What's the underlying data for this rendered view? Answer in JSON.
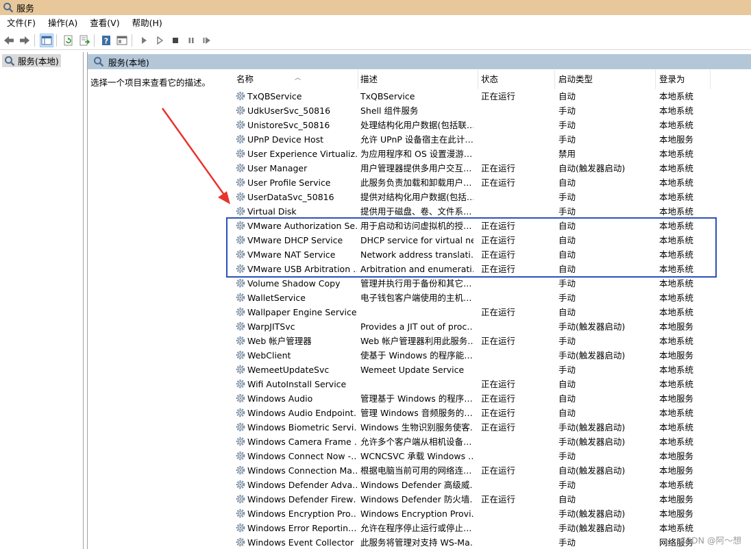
{
  "window": {
    "title": "服务"
  },
  "menu": [
    "文件(F)",
    "操作(A)",
    "查看(V)",
    "帮助(H)"
  ],
  "toolbar": {
    "icons": [
      "back-arrow-icon",
      "forward-arrow-icon",
      "show-console-tree-icon",
      "refresh-icon",
      "export-list-icon",
      "help-icon",
      "properties-icon",
      "start-service-icon",
      "start-service-alt-icon",
      "stop-service-icon",
      "pause-service-icon",
      "resume-service-icon"
    ]
  },
  "tree": {
    "root_label": "服务(本地)"
  },
  "main": {
    "header_label": "服务(本地)",
    "description_hint": "选择一个项目来查看它的描述。"
  },
  "columns": {
    "name": "名称",
    "desc": "描述",
    "status": "状态",
    "startup": "启动类型",
    "logon": "登录为"
  },
  "services": [
    {
      "name": "TxQBService",
      "desc": "TxQBService",
      "status": "正在运行",
      "startup": "自动",
      "logon": "本地系统"
    },
    {
      "name": "UdkUserSvc_50816",
      "desc": "Shell 组件服务",
      "status": "",
      "startup": "手动",
      "logon": "本地系统"
    },
    {
      "name": "UnistoreSvc_50816",
      "desc": "处理结构化用户数据(包括联…",
      "status": "",
      "startup": "手动",
      "logon": "本地系统"
    },
    {
      "name": "UPnP Device Host",
      "desc": "允许 UPnP 设备宿主在此计…",
      "status": "",
      "startup": "手动",
      "logon": "本地服务"
    },
    {
      "name": "User Experience Virtualiz…",
      "desc": "为应用程序和 OS 设置漫游…",
      "status": "",
      "startup": "禁用",
      "logon": "本地系统"
    },
    {
      "name": "User Manager",
      "desc": "用户管理器提供多用户交互…",
      "status": "正在运行",
      "startup": "自动(触发器启动)",
      "logon": "本地系统"
    },
    {
      "name": "User Profile Service",
      "desc": "此服务负责加载和卸载用户…",
      "status": "正在运行",
      "startup": "自动",
      "logon": "本地系统"
    },
    {
      "name": "UserDataSvc_50816",
      "desc": "提供对结构化用户数据(包括…",
      "status": "",
      "startup": "手动",
      "logon": "本地系统"
    },
    {
      "name": "Virtual Disk",
      "desc": "提供用于磁盘、卷、文件系…",
      "status": "",
      "startup": "手动",
      "logon": "本地系统"
    },
    {
      "name": "VMware Authorization Se…",
      "desc": "用于启动和访问虚拟机的授…",
      "status": "正在运行",
      "startup": "自动",
      "logon": "本地系统"
    },
    {
      "name": "VMware DHCP Service",
      "desc": "DHCP service for virtual ne…",
      "status": "正在运行",
      "startup": "自动",
      "logon": "本地系统"
    },
    {
      "name": "VMware NAT Service",
      "desc": "Network address translati…",
      "status": "正在运行",
      "startup": "自动",
      "logon": "本地系统"
    },
    {
      "name": "VMware USB Arbitration …",
      "desc": "Arbitration and enumerati…",
      "status": "正在运行",
      "startup": "自动",
      "logon": "本地系统"
    },
    {
      "name": "Volume Shadow Copy",
      "desc": "管理并执行用于备份和其它…",
      "status": "",
      "startup": "手动",
      "logon": "本地系统"
    },
    {
      "name": "WalletService",
      "desc": "电子钱包客户端使用的主机…",
      "status": "",
      "startup": "手动",
      "logon": "本地系统"
    },
    {
      "name": "Wallpaper Engine Service",
      "desc": "",
      "status": "正在运行",
      "startup": "自动",
      "logon": "本地系统"
    },
    {
      "name": "WarpJITSvc",
      "desc": "Provides a JIT out of proc…",
      "status": "",
      "startup": "手动(触发器启动)",
      "logon": "本地服务"
    },
    {
      "name": "Web 帐户管理器",
      "desc": "Web 帐户管理器利用此服务…",
      "status": "正在运行",
      "startup": "手动",
      "logon": "本地系统"
    },
    {
      "name": "WebClient",
      "desc": "使基于 Windows 的程序能…",
      "status": "",
      "startup": "手动(触发器启动)",
      "logon": "本地服务"
    },
    {
      "name": "WemeetUpdateSvc",
      "desc": "Wemeet Update Service",
      "status": "",
      "startup": "手动",
      "logon": "本地系统"
    },
    {
      "name": "Wifi AutoInstall Service",
      "desc": "",
      "status": "正在运行",
      "startup": "自动",
      "logon": "本地系统"
    },
    {
      "name": "Windows Audio",
      "desc": "管理基于 Windows 的程序…",
      "status": "正在运行",
      "startup": "自动",
      "logon": "本地服务"
    },
    {
      "name": "Windows Audio Endpoint…",
      "desc": "管理 Windows 音频服务的…",
      "status": "正在运行",
      "startup": "自动",
      "logon": "本地系统"
    },
    {
      "name": "Windows Biometric Servi…",
      "desc": "Windows 生物识别服务使客…",
      "status": "正在运行",
      "startup": "手动(触发器启动)",
      "logon": "本地系统"
    },
    {
      "name": "Windows Camera Frame …",
      "desc": "允许多个客户端从相机设备…",
      "status": "",
      "startup": "手动(触发器启动)",
      "logon": "本地系统"
    },
    {
      "name": "Windows Connect Now -…",
      "desc": "WCNCSVC 承载 Windows …",
      "status": "",
      "startup": "手动",
      "logon": "本地服务"
    },
    {
      "name": "Windows Connection Ma…",
      "desc": "根据电脑当前可用的网络连…",
      "status": "正在运行",
      "startup": "自动(触发器启动)",
      "logon": "本地服务"
    },
    {
      "name": "Windows Defender Adva…",
      "desc": "Windows Defender 高级威…",
      "status": "",
      "startup": "手动",
      "logon": "本地系统"
    },
    {
      "name": "Windows Defender Firew…",
      "desc": "Windows Defender 防火墙…",
      "status": "正在运行",
      "startup": "自动",
      "logon": "本地服务"
    },
    {
      "name": "Windows Encryption Pro…",
      "desc": "Windows Encryption Provi…",
      "status": "",
      "startup": "手动(触发器启动)",
      "logon": "本地服务"
    },
    {
      "name": "Windows Error Reportin…",
      "desc": "允许在程序停止运行或停止…",
      "status": "",
      "startup": "手动(触发器启动)",
      "logon": "本地系统"
    },
    {
      "name": "Windows Event Collector",
      "desc": "此服务将管理对支持 WS-Ma…",
      "status": "",
      "startup": "手动",
      "logon": "网络服务"
    }
  ],
  "annotations": {
    "watermark": "CSDN @阿～想",
    "highlight_color": "#2b50b8",
    "arrow_color": "#e8342c"
  }
}
